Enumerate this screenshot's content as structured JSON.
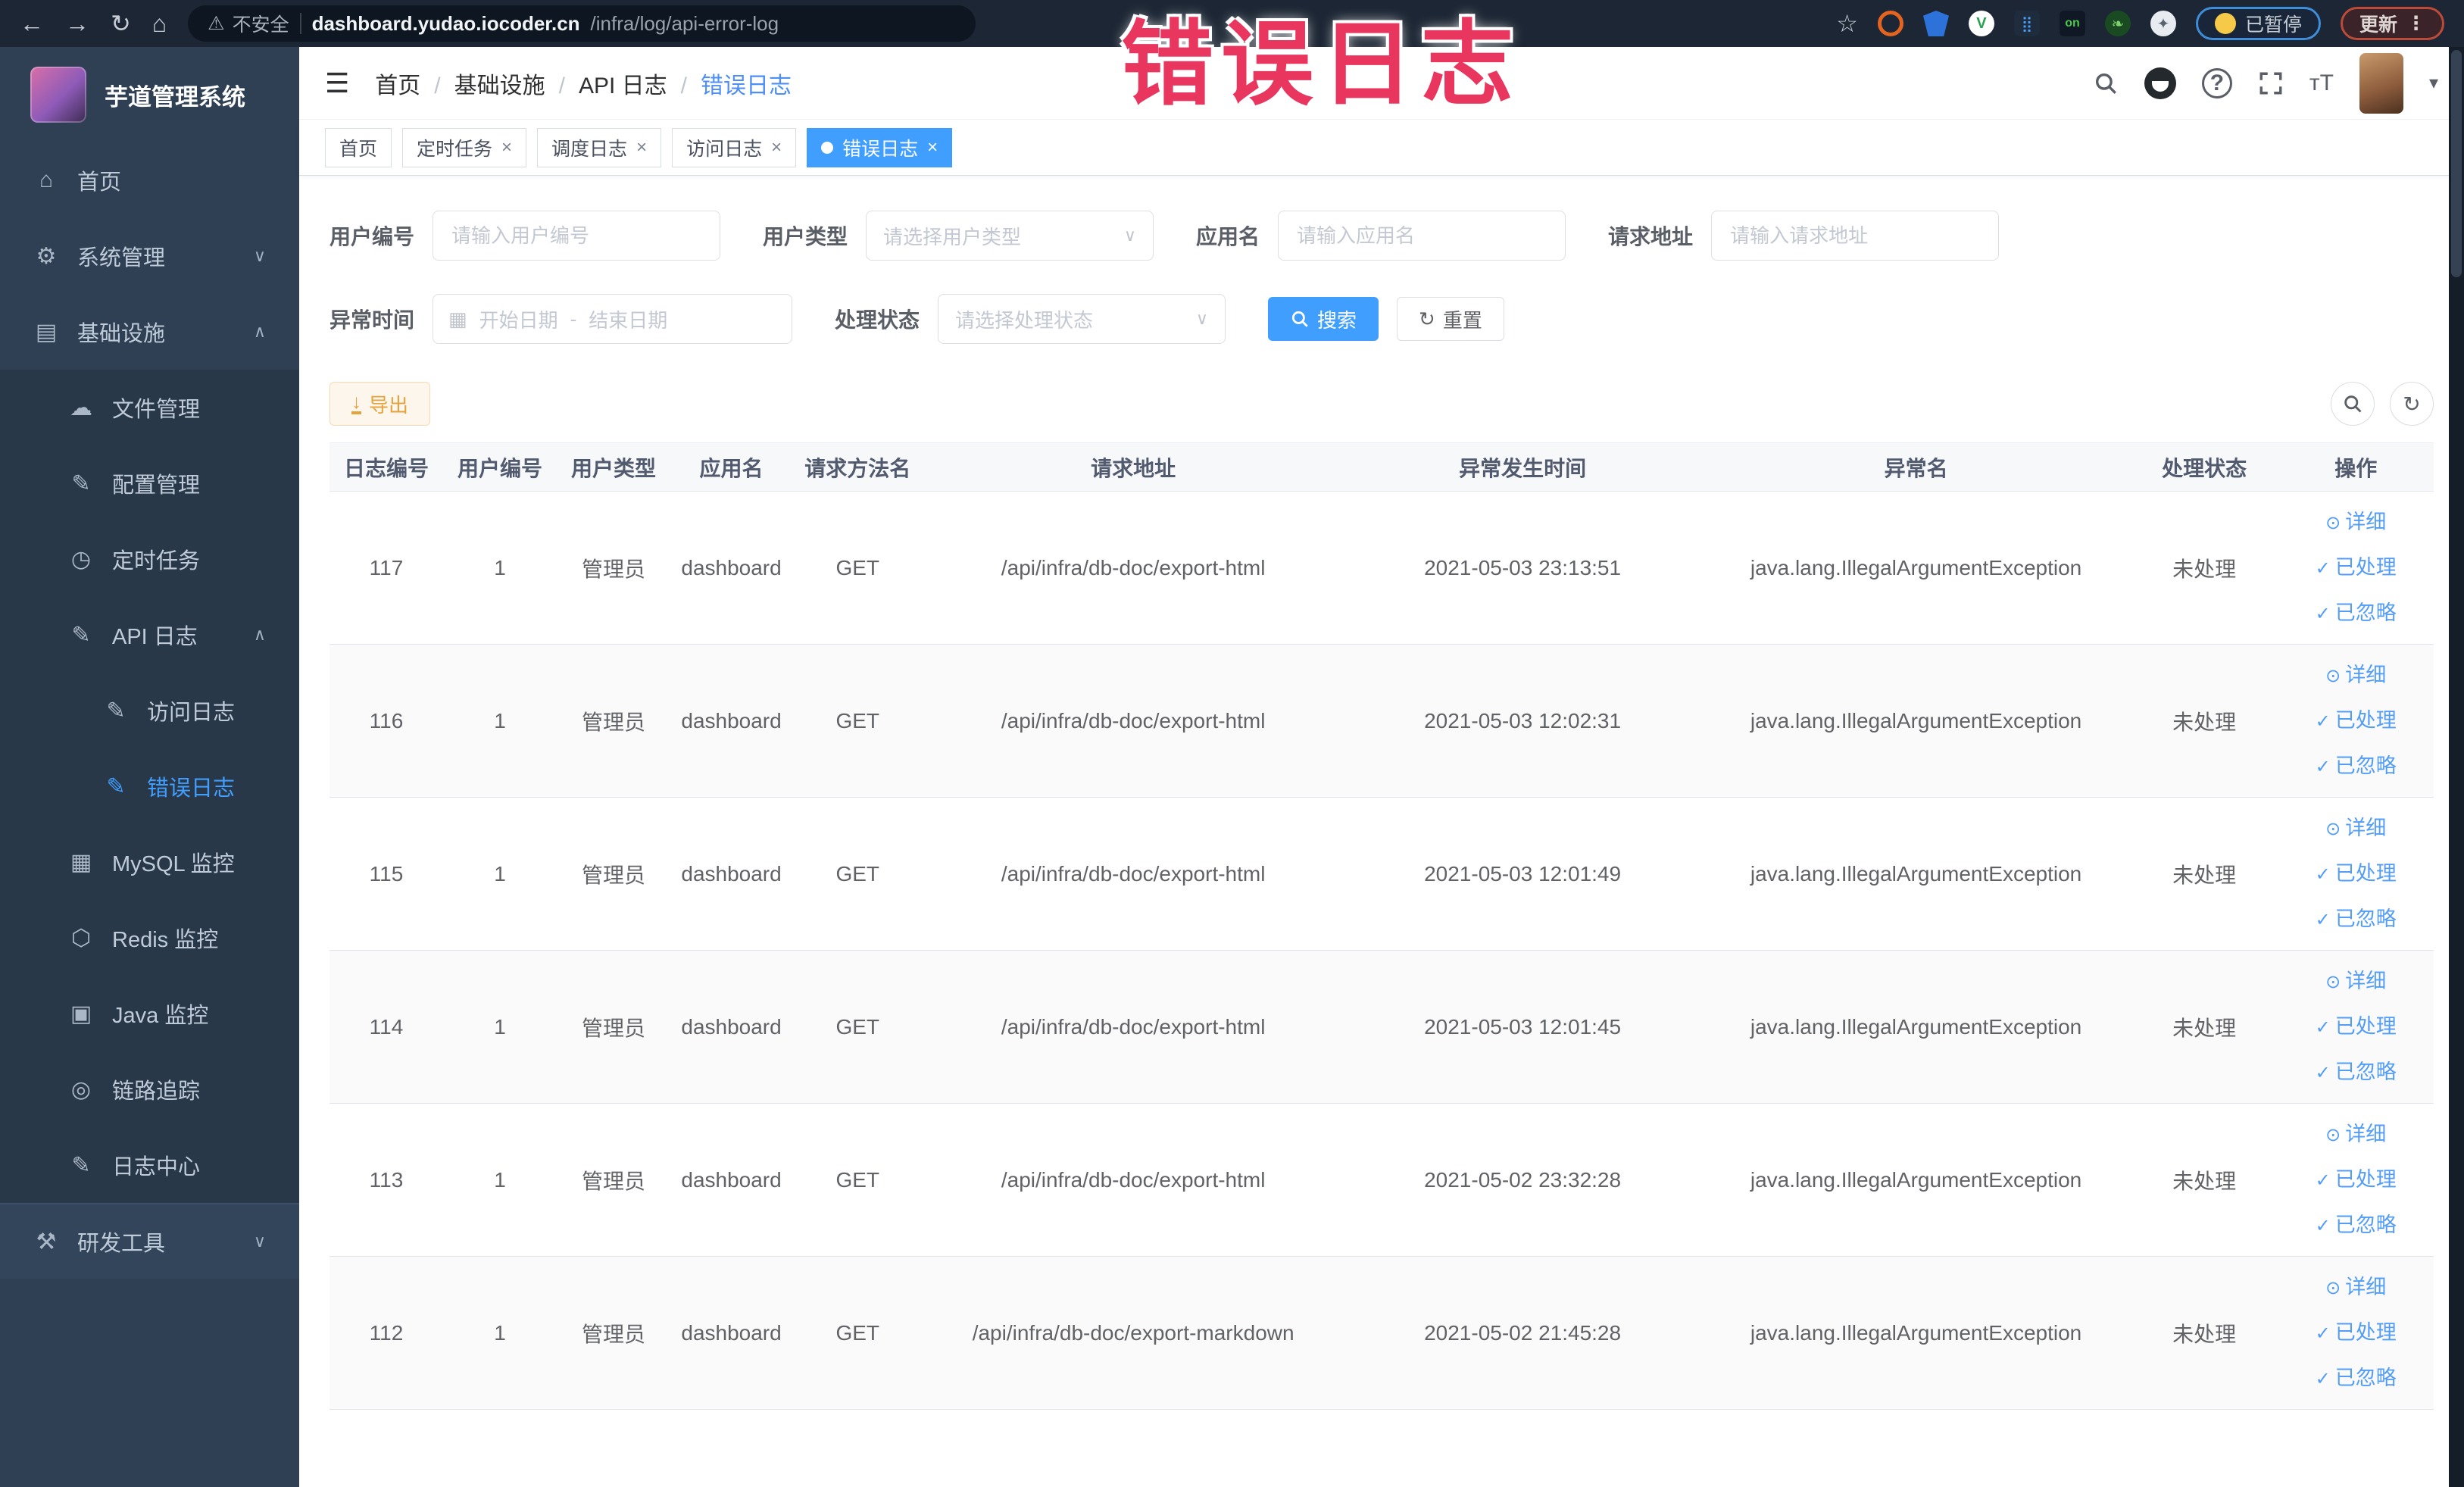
{
  "browser": {
    "security_label": "不安全",
    "url_host": "dashboard.yudao.iocoder.cn",
    "url_path": "/infra/log/api-error-log",
    "paused_badge": "已暂停",
    "update_badge": "更新"
  },
  "annotation": {
    "text": "错误日志",
    "color": "#e8365e"
  },
  "sidebar": {
    "title": "芋道管理系统",
    "items": [
      {
        "label": "首页",
        "level": "top",
        "icon": "home-icon"
      },
      {
        "label": "系统管理",
        "level": "top",
        "icon": "gear-icon",
        "arrow": "down"
      },
      {
        "label": "基础设施",
        "level": "top",
        "icon": "monitor-icon",
        "arrow": "up"
      },
      {
        "label": "文件管理",
        "level": "sub",
        "icon": "cloud-upload-icon"
      },
      {
        "label": "配置管理",
        "level": "sub",
        "icon": "config-edit-icon"
      },
      {
        "label": "定时任务",
        "level": "sub",
        "icon": "timer-icon"
      },
      {
        "label": "API 日志",
        "level": "sub",
        "icon": "api-log-icon",
        "arrow": "up"
      },
      {
        "label": "访问日志",
        "level": "subsub",
        "icon": "access-log-icon"
      },
      {
        "label": "错误日志",
        "level": "subsub",
        "icon": "error-log-icon",
        "active": true
      },
      {
        "label": "MySQL 监控",
        "level": "sub",
        "icon": "mysql-icon"
      },
      {
        "label": "Redis 监控",
        "level": "sub",
        "icon": "redis-icon"
      },
      {
        "label": "Java 监控",
        "level": "sub",
        "icon": "java-icon"
      },
      {
        "label": "链路追踪",
        "level": "sub",
        "icon": "trace-eye-icon"
      },
      {
        "label": "日志中心",
        "level": "sub",
        "icon": "log-center-icon"
      },
      {
        "label": "研发工具",
        "level": "top",
        "icon": "toolbox-icon",
        "arrow": "down",
        "section": true
      }
    ]
  },
  "breadcrumb": [
    "首页",
    "基础设施",
    "API 日志",
    "错误日志"
  ],
  "tags": [
    {
      "label": "首页",
      "closable": false,
      "active": false
    },
    {
      "label": "定时任务",
      "closable": true,
      "active": false
    },
    {
      "label": "调度日志",
      "closable": true,
      "active": false
    },
    {
      "label": "访问日志",
      "closable": true,
      "active": false
    },
    {
      "label": "错误日志",
      "closable": true,
      "active": true
    }
  ],
  "filters": {
    "user_id": {
      "label": "用户编号",
      "placeholder": "请输入用户编号"
    },
    "user_type": {
      "label": "用户类型",
      "placeholder": "请选择用户类型"
    },
    "app_name": {
      "label": "应用名",
      "placeholder": "请输入应用名"
    },
    "req_url": {
      "label": "请求地址",
      "placeholder": "请输入请求地址"
    },
    "time": {
      "label": "异常时间",
      "start_placeholder": "开始日期",
      "separator": "-",
      "end_placeholder": "结束日期"
    },
    "status": {
      "label": "处理状态",
      "placeholder": "请选择处理状态"
    },
    "search_label": "搜索",
    "reset_label": "重置"
  },
  "toolbar": {
    "export_label": "导出"
  },
  "table": {
    "columns": [
      "日志编号",
      "用户编号",
      "用户类型",
      "应用名",
      "请求方法名",
      "请求地址",
      "异常发生时间",
      "异常名",
      "处理状态",
      "操作"
    ],
    "action_labels": [
      {
        "icon": "eye-icon",
        "label": "详细"
      },
      {
        "icon": "check-icon",
        "label": "已处理"
      },
      {
        "icon": "check-icon",
        "label": "已忽略"
      }
    ],
    "rows": [
      {
        "id": "117",
        "user_id": "1",
        "user_type": "管理员",
        "app_name": "dashboard",
        "method": "GET",
        "url": "/api/infra/db-doc/export-html",
        "time": "2021-05-03 23:13:51",
        "exception": "java.lang.IllegalArgumentException",
        "status": "未处理"
      },
      {
        "id": "116",
        "user_id": "1",
        "user_type": "管理员",
        "app_name": "dashboard",
        "method": "GET",
        "url": "/api/infra/db-doc/export-html",
        "time": "2021-05-03 12:02:31",
        "exception": "java.lang.IllegalArgumentException",
        "status": "未处理"
      },
      {
        "id": "115",
        "user_id": "1",
        "user_type": "管理员",
        "app_name": "dashboard",
        "method": "GET",
        "url": "/api/infra/db-doc/export-html",
        "time": "2021-05-03 12:01:49",
        "exception": "java.lang.IllegalArgumentException",
        "status": "未处理"
      },
      {
        "id": "114",
        "user_id": "1",
        "user_type": "管理员",
        "app_name": "dashboard",
        "method": "GET",
        "url": "/api/infra/db-doc/export-html",
        "time": "2021-05-03 12:01:45",
        "exception": "java.lang.IllegalArgumentException",
        "status": "未处理"
      },
      {
        "id": "113",
        "user_id": "1",
        "user_type": "管理员",
        "app_name": "dashboard",
        "method": "GET",
        "url": "/api/infra/db-doc/export-html",
        "time": "2021-05-02 23:32:28",
        "exception": "java.lang.IllegalArgumentException",
        "status": "未处理"
      },
      {
        "id": "112",
        "user_id": "1",
        "user_type": "管理员",
        "app_name": "dashboard",
        "method": "GET",
        "url": "/api/infra/db-doc/export-markdown",
        "time": "2021-05-02 21:45:28",
        "exception": "java.lang.IllegalArgumentException",
        "status": "未处理"
      }
    ]
  },
  "colors": {
    "accent": "#409eff",
    "annotation": "#e8365e",
    "warn": "#e6a23c",
    "sidebar_bg": "#2f4054",
    "submenu_bg": "#293848"
  }
}
